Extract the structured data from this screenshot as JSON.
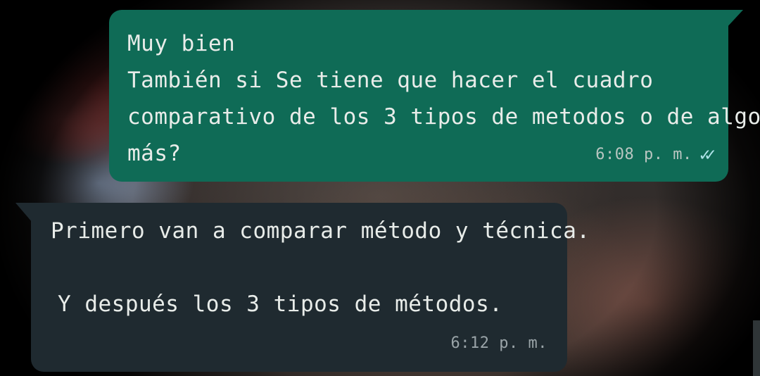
{
  "messages": {
    "outgoing": {
      "lines": [
        "Muy bien",
        "También si Se tiene que hacer el cuadro",
        "comparativo de los 3 tipos de metodos o de algo",
        "más?"
      ],
      "time": "6:08 p. m.",
      "status_icon": "double-check-icon"
    },
    "incoming": {
      "lines": [
        "Primero van a comparar método y técnica.",
        "Y después los 3 tipos de métodos."
      ],
      "time": "6:12 p. m."
    }
  },
  "colors": {
    "outgoing_bubble": "#0f6b56",
    "incoming_bubble": "#1f2a30",
    "read_ticks": "#aee3e8"
  }
}
